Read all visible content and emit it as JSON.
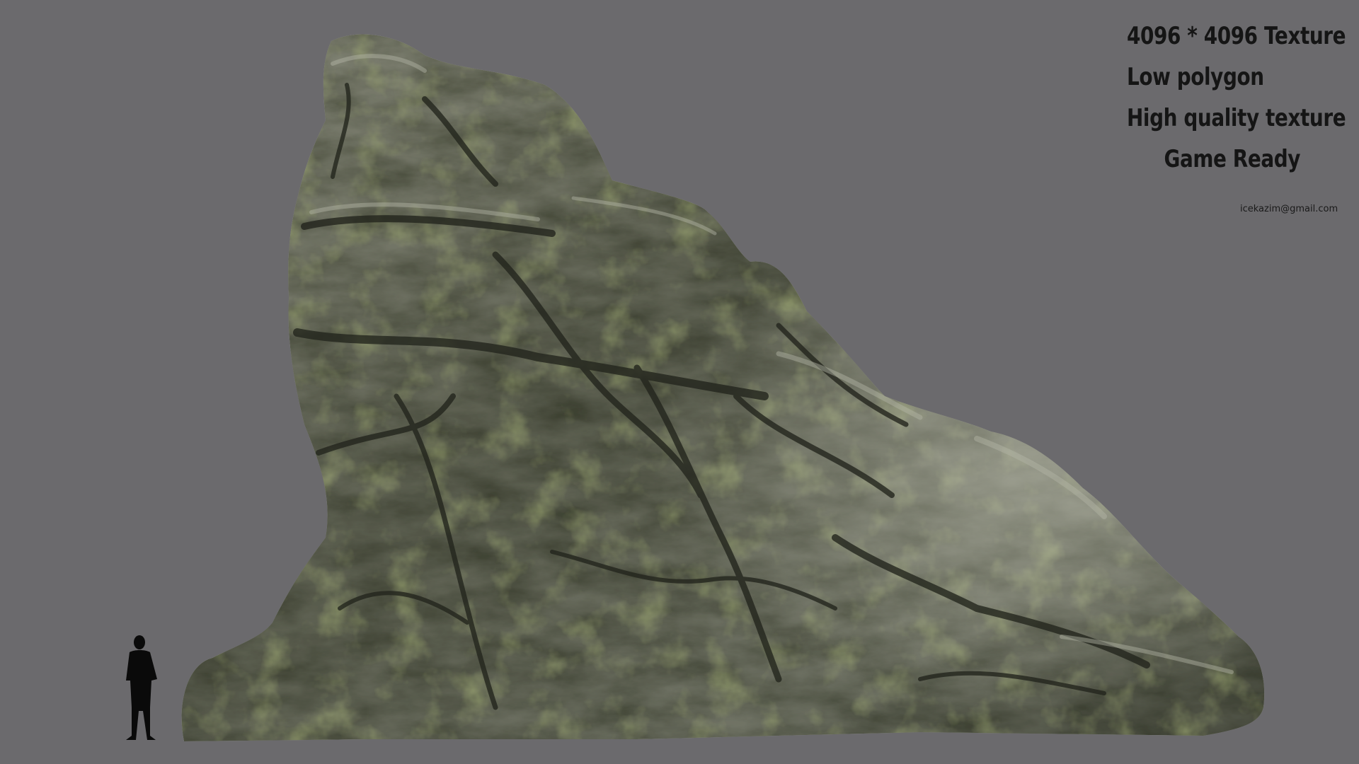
{
  "overlay": {
    "lines": [
      "4096 * 4096 Texture",
      "Low polygon",
      "High quality texture",
      "Game Ready"
    ],
    "contact": "icekazim@gmail.com"
  },
  "colors": {
    "background": "#6b6a6d",
    "rock_base": "#6e715f",
    "rock_dark": "#2b2d24",
    "moss": "#6f7d34",
    "silhouette": "#0a0a0a"
  },
  "icons": {
    "rock": "rock-model-icon",
    "scale_figure": "human-silhouette-icon"
  }
}
